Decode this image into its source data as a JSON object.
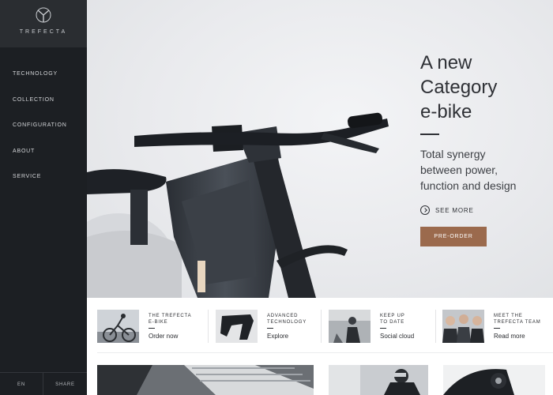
{
  "brand": {
    "name": "TREFECTA",
    "logo": "trefecta-tri-spoke-logo"
  },
  "nav": {
    "items": [
      {
        "label": "TECHNOLOGY"
      },
      {
        "label": "COLLECTION"
      },
      {
        "label": "CONFIGURATION"
      },
      {
        "label": "ABOUT"
      },
      {
        "label": "SERVICE"
      }
    ]
  },
  "footer": {
    "lang_label": "EN",
    "share_label": "SHARE"
  },
  "hero": {
    "title_lines": [
      "A new",
      "Category",
      "e-bike"
    ],
    "subtitle_lines": [
      "Total synergy",
      "between power,",
      "function and design"
    ],
    "see_more_label": "SEE MORE",
    "see_more_icon": "arrow-right-circle-icon",
    "cta_label": "PRE-ORDER",
    "cta_color": "#9b6a4d"
  },
  "features": [
    {
      "title_lines": [
        "THE TREFECTA",
        "E-BIKE"
      ],
      "link": "Order now"
    },
    {
      "title_lines": [
        "ADVANCED",
        "TECHNOLOGY"
      ],
      "link": "Explore"
    },
    {
      "title_lines": [
        "KEEP UP",
        "TO DATE"
      ],
      "link": "Social cloud"
    },
    {
      "title_lines": [
        "MEET THE",
        "TREFECTA TEAM"
      ],
      "link": "Read more"
    }
  ],
  "colors": {
    "sidebar": "#1c1f23",
    "logo_block": "#2a2d31",
    "accent": "#9b6a4d"
  }
}
